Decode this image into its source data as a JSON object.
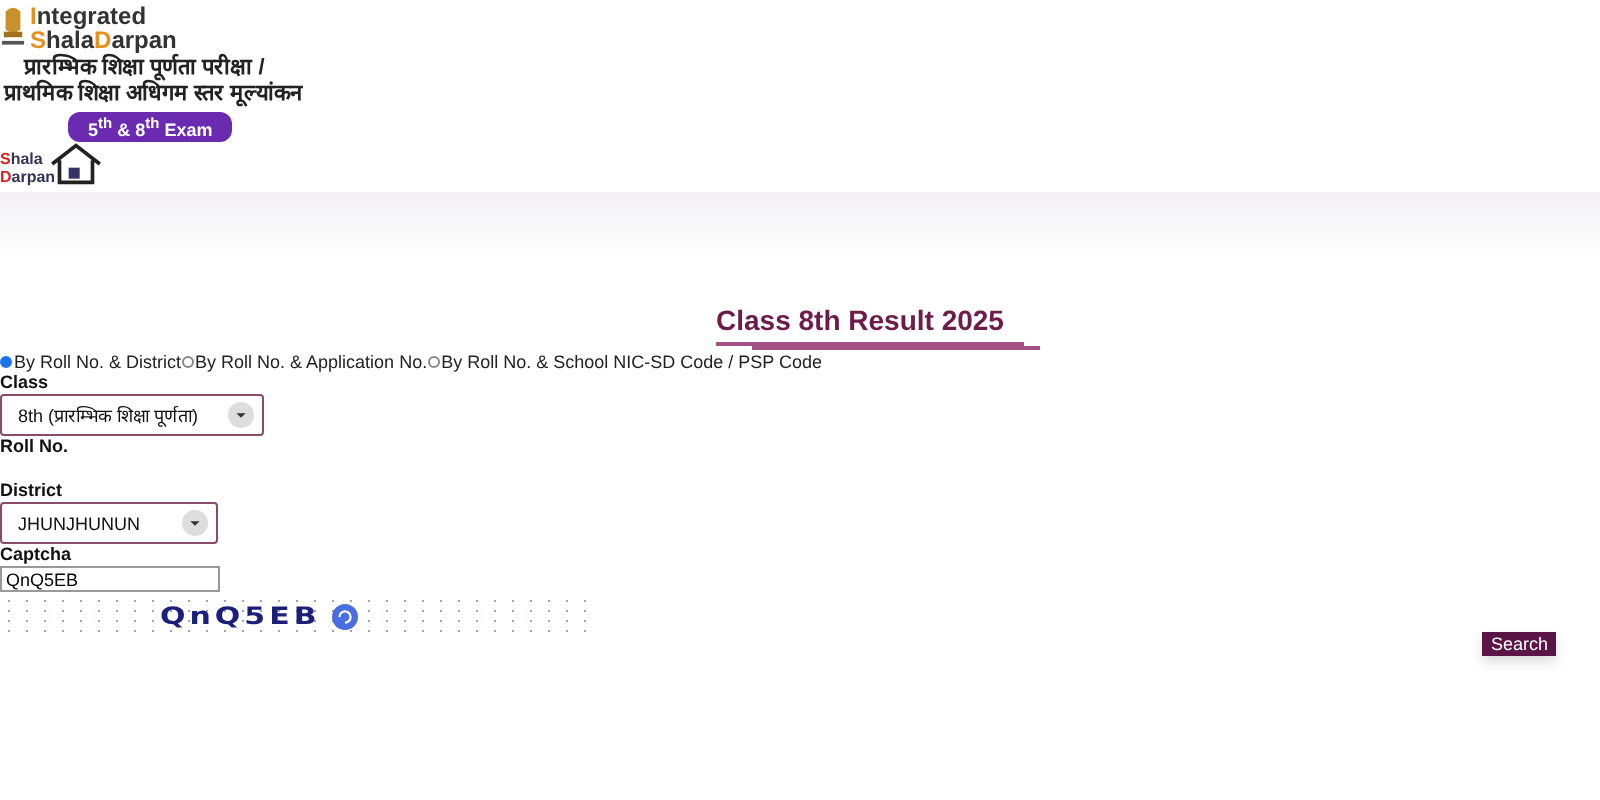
{
  "header": {
    "brand_line1": "Integrated",
    "brand_line2_parts": [
      "Shala",
      "Darpan"
    ],
    "hindi_line1": "प्रारम्भिक शिक्षा पूर्णता परीक्षा /",
    "hindi_line2": "प्राथमिक शिक्षा अधिगम स्तर मूल्यांकन",
    "exam_badge": "5$^{th}$ & 8$^{th}$ Exam",
    "small_logo_parts": [
      "Shala",
      "Darpan"
    ]
  },
  "title": "Class 8th Result 2025",
  "search_modes": [
    {
      "label": "By Roll No. & District",
      "selected": true
    },
    {
      "label": "By Roll No. & Application No.",
      "selected": false
    },
    {
      "label": "By Roll No. & School NIC-SD Code / PSP Code",
      "selected": false
    }
  ],
  "form": {
    "class_label": "Class",
    "class_value": "8th (प्रारम्भिक शिक्षा पूर्णता)",
    "roll_label": "Roll No.",
    "district_label": "District",
    "district_value": "JHUNJHUNUN",
    "captcha_label": "Captcha",
    "captcha_value": "QnQ5EB",
    "captcha_image_text": "QnQ5EB"
  },
  "search_button": "Search"
}
